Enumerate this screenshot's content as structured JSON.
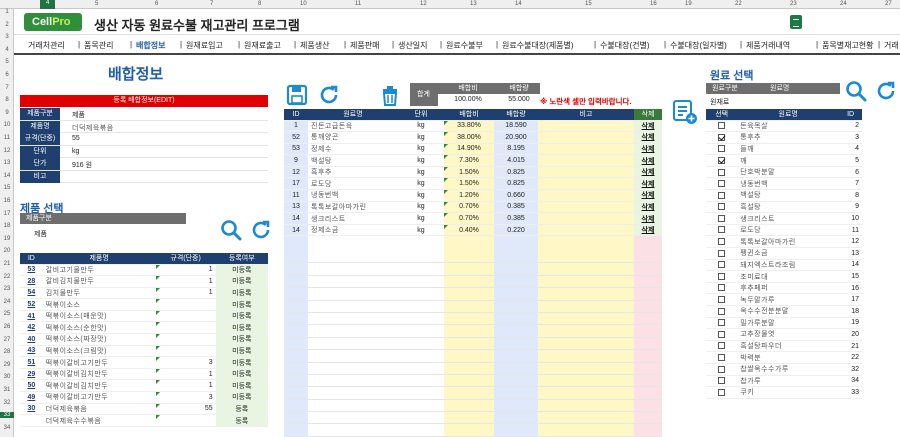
{
  "excel": {
    "columns": [
      "4",
      "5",
      "6",
      "7",
      "8",
      "10",
      "11",
      "12",
      "13",
      "14",
      "15",
      "16",
      "19",
      "22",
      "23",
      "24",
      "27"
    ],
    "rows": [
      "1",
      "2",
      "3",
      "4",
      "5",
      "6",
      "7",
      "8",
      "9",
      "10",
      "11",
      "12",
      "13",
      "14",
      "15",
      "16",
      "17",
      "18",
      "19",
      "20",
      "21",
      "22",
      "23",
      "24",
      "25",
      "26",
      "27",
      "28",
      "29",
      "30",
      "31",
      "32",
      "33",
      "34"
    ]
  },
  "app": {
    "logo_left": "Cell",
    "logo_right": "Pro",
    "title": "생산 자동 원료수불 재고관리 프로그램",
    "excel_icon": "excel-icon"
  },
  "menu": [
    "거래처관리",
    "품목관리",
    "배합정보",
    "원재료입고",
    "원재료출고",
    "제품생산",
    "제품판매",
    "생산일지",
    "원료수불부",
    "원료수불대장(제품별)",
    "수불대장(건별)",
    "수불대장(일자별)",
    "제품거래내역",
    "품목별재고현황",
    "거래"
  ],
  "left": {
    "title": "배합정보",
    "edit_bar": "등록 배합정보(EDIT)",
    "form": [
      {
        "k": "제품구분",
        "v": "제품"
      },
      {
        "k": "제품명",
        "v": "더덕제육볶음"
      },
      {
        "k": "규격(단중)",
        "v": "55"
      },
      {
        "k": "단위",
        "v": "kg"
      },
      {
        "k": "단가",
        "v": "916 원"
      },
      {
        "k": "비고",
        "v": ""
      }
    ],
    "select_title": "제품 선택",
    "filter_label": "제품구분",
    "filter_value": "제품",
    "table_headers": [
      "ID",
      "제품명",
      "규격(단중)",
      "등록여부"
    ],
    "rows": [
      {
        "id": "53",
        "name": "갈비고기물만두",
        "spec": "1",
        "reg": "미등록"
      },
      {
        "id": "28",
        "name": "갈비김치물만두",
        "spec": "1",
        "reg": "미등록"
      },
      {
        "id": "54",
        "name": "김치물만두",
        "spec": "1",
        "reg": "미등록"
      },
      {
        "id": "52",
        "name": "떡볶이소스",
        "spec": "",
        "reg": "미등록"
      },
      {
        "id": "41",
        "name": "떡볶이소스(매운맛)",
        "spec": "",
        "reg": "미등록"
      },
      {
        "id": "42",
        "name": "떡볶이소스(순한맛)",
        "spec": "",
        "reg": "미등록"
      },
      {
        "id": "40",
        "name": "떡볶이소스(짜장맛)",
        "spec": "",
        "reg": "미등록"
      },
      {
        "id": "43",
        "name": "떡볶이소스(크림맛)",
        "spec": "",
        "reg": "미등록"
      },
      {
        "id": "51",
        "name": "떡볶이갈비고기만두",
        "spec": "3",
        "reg": "미등록"
      },
      {
        "id": "29",
        "name": "떡볶이갈비김치만두",
        "spec": "1",
        "reg": "미등록"
      },
      {
        "id": "50",
        "name": "떡볶이갈비김치만두",
        "spec": "1",
        "reg": "미등록"
      },
      {
        "id": "49",
        "name": "떡볶이갈비고기만두",
        "spec": "3",
        "reg": "미등록"
      },
      {
        "id": "30",
        "name": "더덕제육볶음",
        "spec": "55",
        "reg": "등록"
      },
      {
        "id": "",
        "name": "더덕제육수수볶음",
        "spec": "",
        "reg": "등록"
      }
    ]
  },
  "mid": {
    "sum_label": "합계",
    "ratio_label": "배합비",
    "qty_label": "배합량",
    "ratio_total": "100.00%",
    "qty_total": "55.000",
    "warning": "※ 노란색 셀만 입력바랍니다.",
    "headers": [
      "ID",
      "원료명",
      "단위",
      "배합비",
      "배합량",
      "비고",
      "삭제"
    ],
    "rows": [
      {
        "id": "1",
        "name": "진돈고급돈육",
        "unit": "kg",
        "ratio": "33.80%",
        "qty": "18.590",
        "del": "삭제"
      },
      {
        "id": "52",
        "name": "통깨양곤",
        "unit": "kg",
        "ratio": "38.00%",
        "qty": "20.900",
        "del": "삭제"
      },
      {
        "id": "53",
        "name": "정제수",
        "unit": "kg",
        "ratio": "14.90%",
        "qty": "8.195",
        "del": "삭제"
      },
      {
        "id": "9",
        "name": "백설탕",
        "unit": "kg",
        "ratio": "7.30%",
        "qty": "4.015",
        "del": "삭제"
      },
      {
        "id": "12",
        "name": "흑후추",
        "unit": "kg",
        "ratio": "1.50%",
        "qty": "0.825",
        "del": "삭제"
      },
      {
        "id": "17",
        "name": "로도당",
        "unit": "kg",
        "ratio": "1.50%",
        "qty": "0.825",
        "del": "삭제"
      },
      {
        "id": "11",
        "name": "냉동번백",
        "unit": "kg",
        "ratio": "1.20%",
        "qty": "0.660",
        "del": "삭제"
      },
      {
        "id": "13",
        "name": "톡톡보갈아마가린",
        "unit": "kg",
        "ratio": "0.70%",
        "qty": "0.385",
        "del": "삭제"
      },
      {
        "id": "14",
        "name": "생크리스트",
        "unit": "kg",
        "ratio": "0.70%",
        "qty": "0.385",
        "del": "삭제"
      },
      {
        "id": "14",
        "name": "정제소금",
        "unit": "kg",
        "ratio": "0.40%",
        "qty": "0.220",
        "del": "삭제"
      }
    ]
  },
  "right": {
    "title": "원료 선택",
    "filter_headers": [
      "원료구분",
      "원료명"
    ],
    "filter_value": "원재료",
    "headers": [
      "선택",
      "원료명",
      "ID"
    ],
    "rows": [
      {
        "chk": false,
        "name": "돈육목살",
        "id": "2"
      },
      {
        "chk": true,
        "name": "통후추",
        "id": "3"
      },
      {
        "chk": false,
        "name": "들깨",
        "id": "4"
      },
      {
        "chk": true,
        "name": "깨",
        "id": "5"
      },
      {
        "chk": false,
        "name": "단호박분말",
        "id": "6"
      },
      {
        "chk": false,
        "name": "냉동번백",
        "id": "7"
      },
      {
        "chk": false,
        "name": "백설탕",
        "id": "8"
      },
      {
        "chk": false,
        "name": "흑설탕",
        "id": "9"
      },
      {
        "chk": false,
        "name": "생크리스트",
        "id": "10"
      },
      {
        "chk": false,
        "name": "로도당",
        "id": "11"
      },
      {
        "chk": false,
        "name": "톡톡보갈아마가린",
        "id": "12"
      },
      {
        "chk": false,
        "name": "펭귄소금",
        "id": "13"
      },
      {
        "chk": false,
        "name": "돼지엑스트라조림",
        "id": "14"
      },
      {
        "chk": false,
        "name": "조미료대",
        "id": "15"
      },
      {
        "chk": false,
        "name": "후추페퍼",
        "id": "16"
      },
      {
        "chk": false,
        "name": "녹두말가루",
        "id": "17"
      },
      {
        "chk": false,
        "name": "옥수수전분분말",
        "id": "18"
      },
      {
        "chk": false,
        "name": "밀가루분말",
        "id": "19"
      },
      {
        "chk": false,
        "name": "고추장물엿",
        "id": "20"
      },
      {
        "chk": false,
        "name": "흑설탕파우더",
        "id": "21"
      },
      {
        "chk": false,
        "name": "박력분",
        "id": "22"
      },
      {
        "chk": false,
        "name": "찹쌀옥수수가루",
        "id": "32"
      },
      {
        "chk": false,
        "name": "찹가루",
        "id": "34"
      },
      {
        "chk": false,
        "name": "쿠키",
        "id": "33"
      }
    ]
  }
}
